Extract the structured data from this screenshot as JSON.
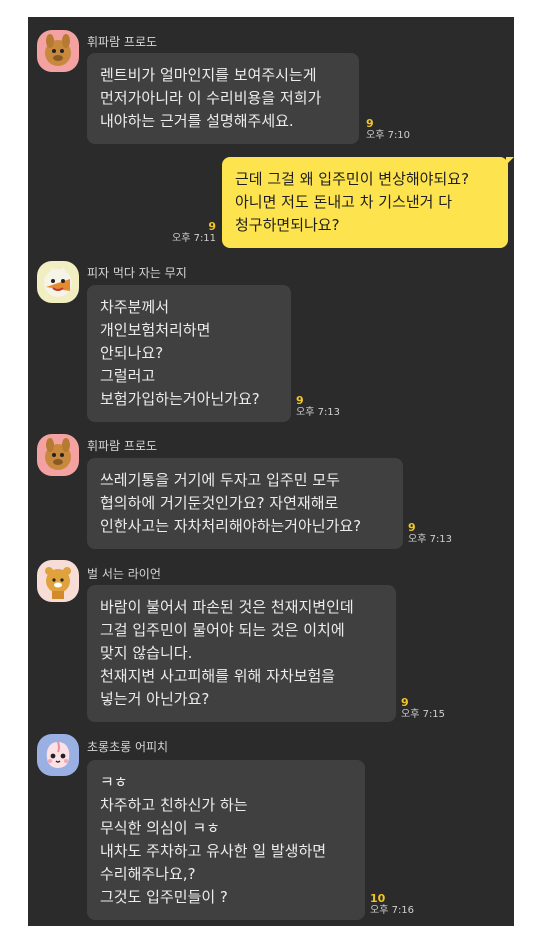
{
  "messages": [
    {
      "sender": "휘파람 프로도",
      "avatar_icon": "frodo-avatar-icon",
      "text": "렌트비가 얼마인지를 보여주시는게\n먼저가아니라 이 수리비용을 저희가\n내야하는 근거를 설명해주세요.",
      "unread": "9",
      "time": "오후 7:10"
    },
    {
      "sender": "",
      "mine": true,
      "text": "근데 그걸 왜 입주민이 변상해야되요?\n아니면 저도 돈내고 차 기스낸거 다\n청구하면되나요?",
      "unread": "9",
      "time": "오후 7:11"
    },
    {
      "sender": "피자 먹다 자는 무지",
      "avatar_icon": "muzi-avatar-icon",
      "text": "차주분께서\n개인보험처리하면\n안되나요?\n그럴러고\n보험가입하는거아닌가요?",
      "unread": "9",
      "time": "오후 7:13"
    },
    {
      "sender": "휘파람 프로도",
      "avatar_icon": "frodo-avatar-icon",
      "text": "쓰레기통을 거기에 두자고 입주민 모두\n협의하에 거기둔것인가요? 자연재해로\n인한사고는 자차처리해야하는거아닌가요?",
      "unread": "9",
      "time": "오후 7:13"
    },
    {
      "sender": "벌 서는 라이언",
      "avatar_icon": "ryan-avatar-icon",
      "text": "바람이 불어서 파손된 것은 천재지변인데\n그걸 입주민이 물어야 되는 것은 이치에\n맞지 않습니다.\n천재지변 사고피해를 위해 자차보험을\n넣는거 아닌가요?",
      "unread": "9",
      "time": "오후 7:15"
    },
    {
      "sender": "초롱초롱 어피치",
      "avatar_icon": "apeach-avatar-icon",
      "text": "ㅋㅎ\n차주하고 친하신가 하는\n무식한 의심이 ㅋㅎ\n내차도 주차하고 유사한 일 발생하면\n수리해주나요,?\n그것도 입주민들이 ?",
      "unread": "10",
      "time": "오후 7:16"
    }
  ],
  "colors": {
    "background": "#2b2b2b",
    "bubble": "#404040",
    "my_bubble": "#fde44e",
    "unread": "#f1c52a"
  }
}
